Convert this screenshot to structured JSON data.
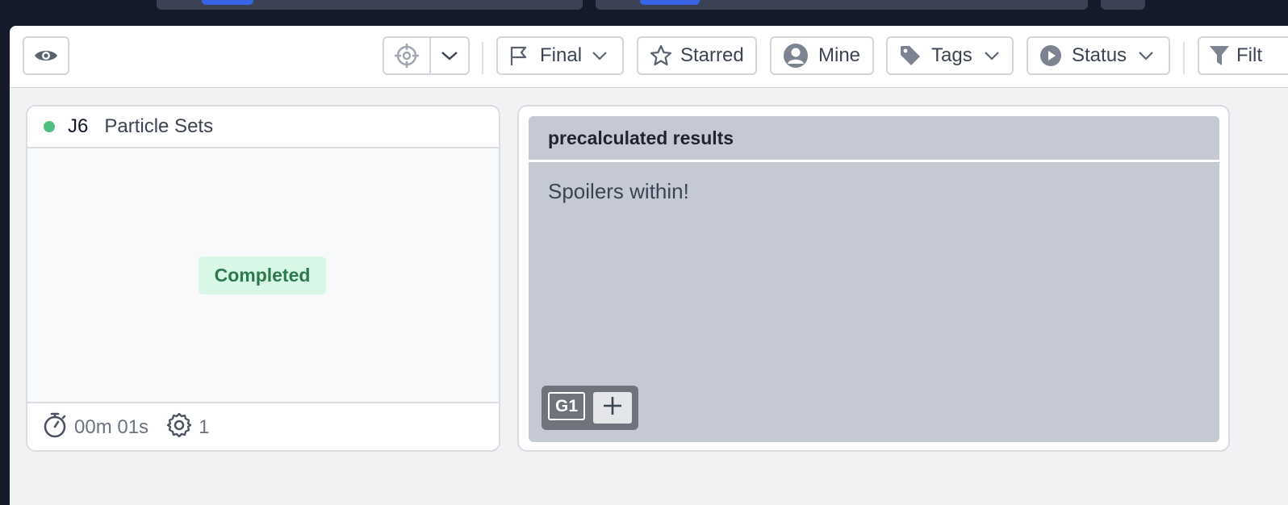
{
  "toolbar": {
    "final_label": "Final",
    "starred_label": "Starred",
    "mine_label": "Mine",
    "tags_label": "Tags",
    "status_label": "Status",
    "filter_label": "Filt"
  },
  "job_card": {
    "status_color": "#4fbf7f",
    "id": "J6",
    "title": "Particle Sets",
    "status": "Completed",
    "duration": "00m 01s",
    "param_count": "1"
  },
  "note_card": {
    "title": "precalculated results",
    "body": "Spoilers within!",
    "group_label": "G1"
  },
  "icons": {
    "view": "eye-icon",
    "target": "crosshair-icon",
    "final": "flag-icon",
    "starred": "star-icon",
    "mine": "user-icon",
    "tags": "tag-icon",
    "status": "play-circle-icon",
    "filter": "filter-icon",
    "duration": "stopwatch-icon",
    "params": "gear-icon",
    "add": "plus-icon"
  }
}
